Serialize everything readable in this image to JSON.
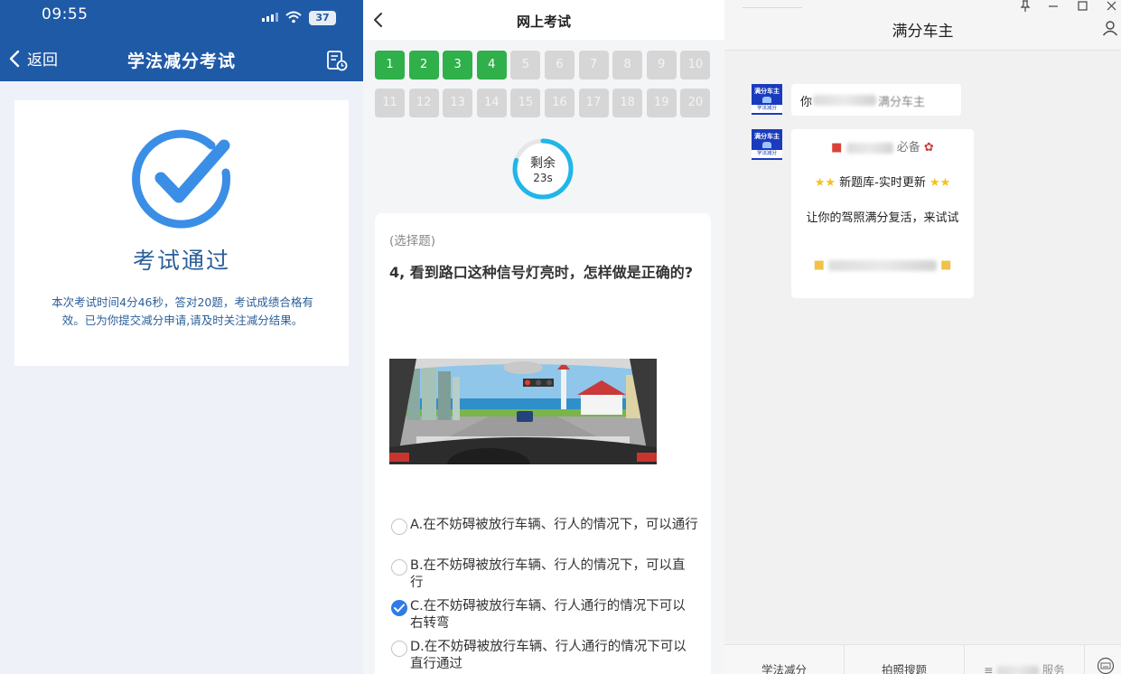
{
  "result": {
    "status": {
      "time": "09:55",
      "battery": "37"
    },
    "nav": {
      "back_label": "返回",
      "title": "学法减分考试"
    },
    "card": {
      "title": "考试通过",
      "description": "本次考试时间4分46秒，答对20题，考试成绩合格有效。已为你提交减分申请,请及时关注减分结果。"
    },
    "colors": {
      "header": "#1f5aa6",
      "accent": "#3a8ee6",
      "text": "#2b5f99"
    }
  },
  "exam": {
    "title": "网上考试",
    "question_numbers": [
      "1",
      "2",
      "3",
      "4",
      "5",
      "6",
      "7",
      "8",
      "9",
      "10",
      "11",
      "12",
      "13",
      "14",
      "15",
      "16",
      "17",
      "18",
      "19",
      "20"
    ],
    "answered_count": 4,
    "timer": {
      "label": "剩余",
      "value": "23s",
      "remaining_fraction": 0.8
    },
    "question": {
      "type": "(选择题)",
      "text": "4, 看到路口这种信号灯亮时，怎样做是正确的?",
      "options": [
        {
          "text": "A.在不妨碍被放行车辆、行人的情况下，可以通行",
          "selected": false
        },
        {
          "text": "B.在不妨碍被放行车辆、行人的情况下，可以直行",
          "selected": false
        },
        {
          "text": "C.在不妨碍被放行车辆、行人通行的情况下可以右转弯",
          "selected": true
        },
        {
          "text": "D.在不妨碍被放行车辆、行人通行的情况下可以直行通过",
          "selected": false
        }
      ]
    },
    "colors": {
      "done": "#2fb04a",
      "pending": "#d6d6d6",
      "selected": "#2f7be8",
      "timer": "#1fb6ea"
    }
  },
  "chat": {
    "title": "满分车主",
    "avatar": {
      "line1": "满分车主",
      "line2": "学法减分"
    },
    "messages": [
      {
        "prefix": "你",
        "suffix": "满分车主"
      },
      {
        "line_promo": "必备",
        "line_bank": "新题库-实时更新",
        "line_invite": "让你的驾照满分复活，来试试"
      }
    ],
    "tabs": [
      "学法减分",
      "拍照搜题",
      "服务"
    ]
  }
}
